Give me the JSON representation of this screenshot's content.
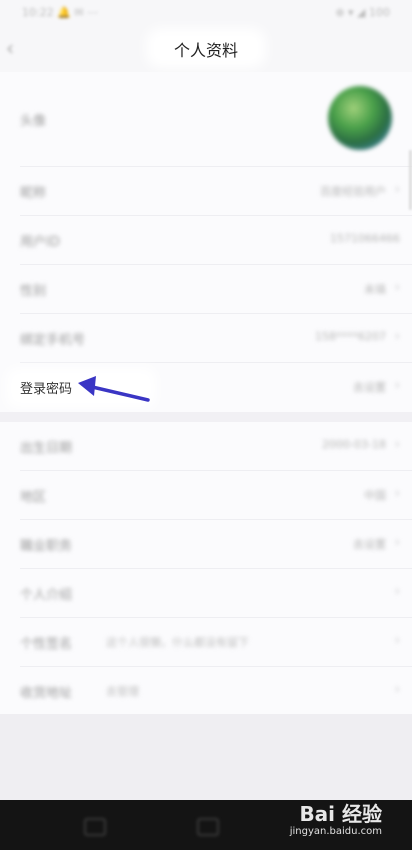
{
  "status_bar": {
    "left_text": "10:22 🔔 ✉ ⋯",
    "right_text": "⊕ ▾ ◢ 100"
  },
  "header": {
    "title": "个人资料",
    "back_icon": "back-arrow-icon"
  },
  "rows": [
    {
      "label": "头像",
      "value": "",
      "avatar": true
    },
    {
      "label": "昵称",
      "value": "百度经验用户"
    },
    {
      "label": "用户ID",
      "value": "1571066466"
    },
    {
      "label": "性别",
      "value": "未填"
    },
    {
      "label": "绑定手机号",
      "value": "158****6207"
    },
    {
      "label": "登录密码",
      "value": "去设置"
    },
    {
      "label": "出生日期",
      "value": "2000-03-18"
    },
    {
      "label": "地区",
      "value": "中国"
    },
    {
      "label": "職业职务",
      "value": "去设置"
    },
    {
      "label": "个人介绍",
      "value": ""
    },
    {
      "label": "个性签名",
      "value": "",
      "extra": "这个人很懒，什么都没有留下"
    },
    {
      "label": "收货地址",
      "value": "",
      "extra": "去管理"
    }
  ],
  "watermark": {
    "brand": "Bai 经验",
    "url": "jingyan.baidu.com"
  },
  "colors": {
    "arrow": "#3a35c4",
    "navbar": "#141414",
    "background": "#f4f3f6"
  }
}
